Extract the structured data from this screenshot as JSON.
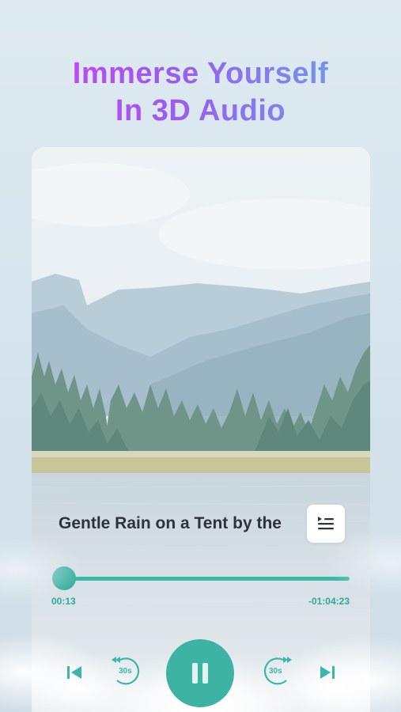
{
  "headline": {
    "line1": "Immerse Yourself",
    "line2": "In 3D Audio"
  },
  "player": {
    "track_title": "Gentle Rain on a Tent by the",
    "elapsed": "00:13",
    "remaining": "-01:04:23",
    "progress_fraction": 0.0,
    "rewind_label": "30s",
    "forward_label": "30s"
  },
  "icons": {
    "queue": "queue-list-icon",
    "previous": "skip-previous-icon",
    "rewind": "rewind-30-icon",
    "play": "play-pause-icon",
    "forward": "forward-30-icon",
    "next": "skip-next-icon"
  },
  "colors": {
    "accent": "#3cb6a6",
    "headline_gradient_start": "#d43df3",
    "headline_gradient_end": "#5fb0ea",
    "title_text": "#2d3439"
  }
}
